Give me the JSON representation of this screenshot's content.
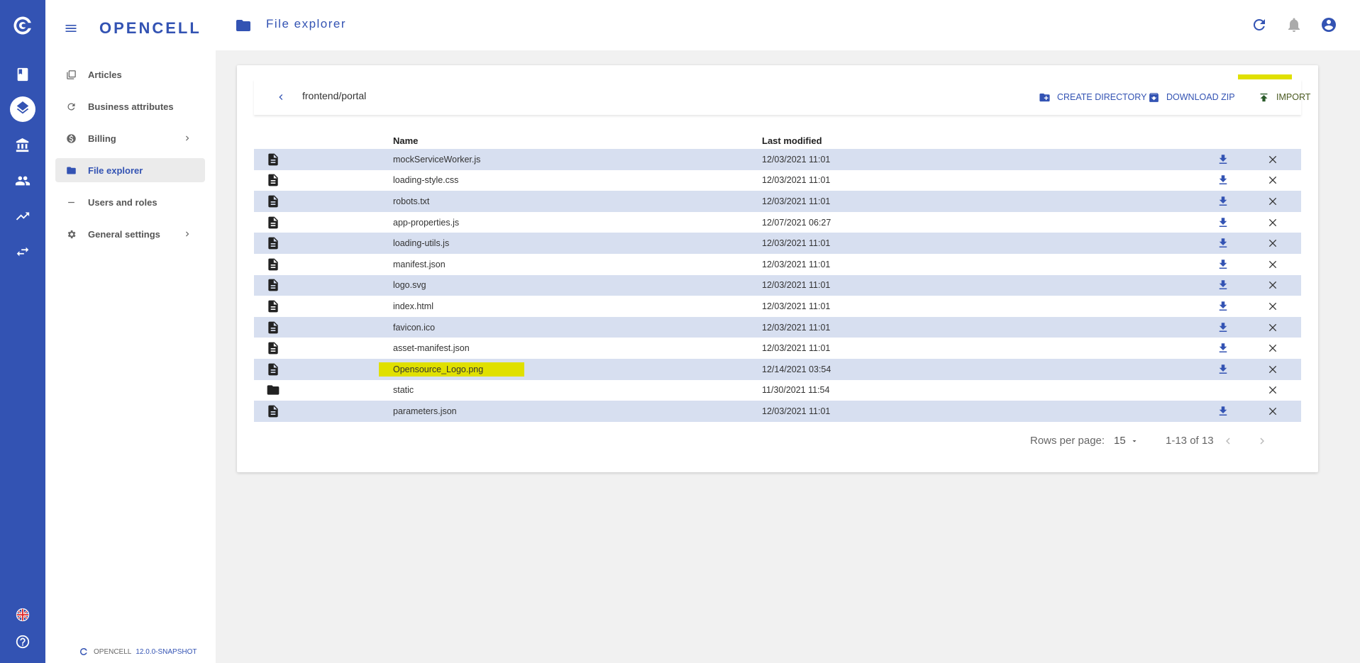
{
  "app": {
    "brand": "OPENCELL",
    "version_label": "OPENCELL",
    "version": "12.0.0-SNAPSHOT"
  },
  "rail": {
    "icons": [
      "opencell-logo-icon",
      "book-icon",
      "layers-icon",
      "bank-icon",
      "people-icon",
      "trending-icon",
      "swap-icon",
      "uk-flag-icon",
      "help-icon"
    ]
  },
  "sidebar": {
    "items": [
      {
        "label": "Articles",
        "icon": "articles-icon"
      },
      {
        "label": "Business attributes",
        "icon": "refresh-icon"
      },
      {
        "label": "Billing",
        "icon": "dollar-icon"
      },
      {
        "label": "File explorer",
        "icon": "folder-icon"
      },
      {
        "label": "Users and roles",
        "icon": "dash-icon"
      },
      {
        "label": "General settings",
        "icon": "gear-icon"
      }
    ]
  },
  "header": {
    "title": "File explorer"
  },
  "toolbar": {
    "path": "frontend/portal",
    "create_directory": "CREATE DIRECTORY",
    "download_zip": "DOWNLOAD ZIP",
    "import": "IMPORT"
  },
  "table": {
    "columns": [
      "Name",
      "Last modified"
    ],
    "rows": [
      {
        "type": "file",
        "name": "mockServiceWorker.js",
        "modified": "12/03/2021 11:01"
      },
      {
        "type": "file",
        "name": "loading-style.css",
        "modified": "12/03/2021 11:01"
      },
      {
        "type": "file",
        "name": "robots.txt",
        "modified": "12/03/2021 11:01"
      },
      {
        "type": "file",
        "name": "app-properties.js",
        "modified": "12/07/2021 06:27"
      },
      {
        "type": "file",
        "name": "loading-utils.js",
        "modified": "12/03/2021 11:01"
      },
      {
        "type": "file",
        "name": "manifest.json",
        "modified": "12/03/2021 11:01"
      },
      {
        "type": "file",
        "name": "logo.svg",
        "modified": "12/03/2021 11:01"
      },
      {
        "type": "file",
        "name": "index.html",
        "modified": "12/03/2021 11:01"
      },
      {
        "type": "file",
        "name": "favicon.ico",
        "modified": "12/03/2021 11:01"
      },
      {
        "type": "file",
        "name": "asset-manifest.json",
        "modified": "12/03/2021 11:01"
      },
      {
        "type": "file",
        "name": "Opensource_Logo.png",
        "modified": "12/14/2021 03:54"
      },
      {
        "type": "folder",
        "name": "static",
        "modified": "11/30/2021 11:54"
      },
      {
        "type": "file",
        "name": "parameters.json",
        "modified": "12/03/2021 11:01"
      }
    ]
  },
  "pagination": {
    "rows_per_page_label": "Rows per page:",
    "rows_per_page_value": "15",
    "range": "1-13 of 13"
  },
  "colors": {
    "primary": "#3353b3",
    "row_alt": "#d7dff0",
    "highlight": "#e0e000"
  }
}
